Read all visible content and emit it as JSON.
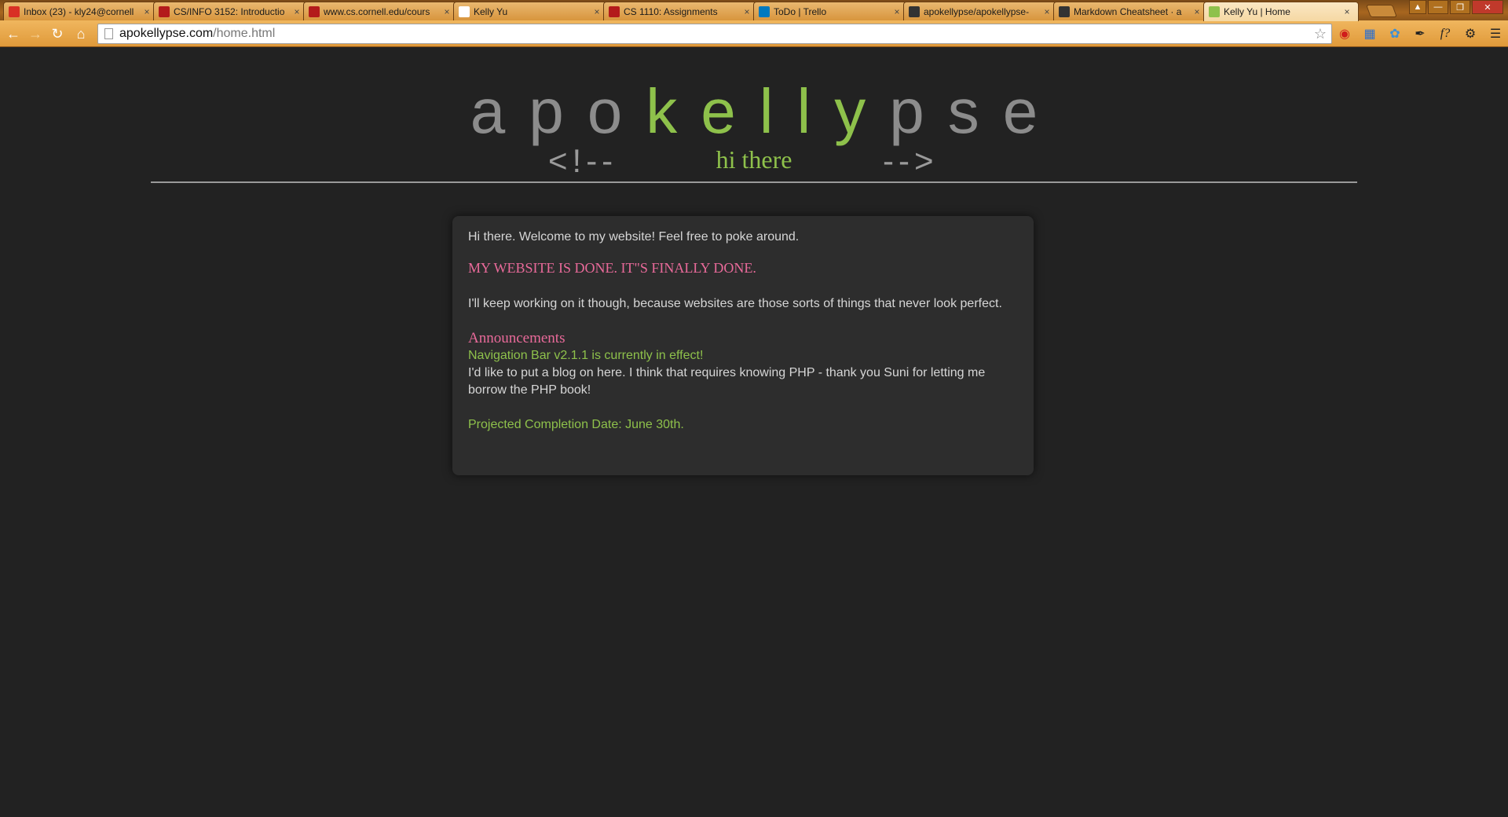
{
  "browser": {
    "tabs": [
      {
        "title": "Inbox (23) - kly24@cornell",
        "favicon": "gmail-icon",
        "color": "#d93025"
      },
      {
        "title": "CS/INFO 3152: Introductio",
        "favicon": "cornell-icon",
        "color": "#b31b1b"
      },
      {
        "title": "www.cs.cornell.edu/cours",
        "favicon": "cornell-icon",
        "color": "#b31b1b"
      },
      {
        "title": "Kelly Yu",
        "favicon": "page-icon",
        "color": "#ffffff"
      },
      {
        "title": "CS 1110: Assignments",
        "favicon": "cornell-icon",
        "color": "#b31b1b"
      },
      {
        "title": "ToDo | Trello",
        "favicon": "trello-icon",
        "color": "#0079bf"
      },
      {
        "title": "apokellypse/apokellypse-",
        "favicon": "github-icon",
        "color": "#333333"
      },
      {
        "title": "Markdown Cheatsheet · a",
        "favicon": "github-icon",
        "color": "#333333"
      },
      {
        "title": "Kelly Yu | Home",
        "favicon": "v-icon",
        "color": "#8ec14b",
        "active": true
      }
    ],
    "url_host": "apokellypse.com",
    "url_path": "/home.html"
  },
  "site": {
    "title_part1": "apo",
    "title_highlight": "kelly",
    "title_part2": "pse",
    "bracket_left": "<!--",
    "bracket_right": "-->",
    "page_label": "hi there"
  },
  "content": {
    "welcome": "Hi there. Welcome to my website! Feel free to poke around.",
    "done": "MY WEBSITE IS DONE. IT\"S FINALLY DONE.",
    "keep": "I'll keep working on it though, because websites are those sorts of things that never look perfect.",
    "announcements_title": "Announcements",
    "navbar_note": "Navigation Bar v2.1.1 is currently in effect!",
    "blog_note": "I'd like to put a blog on here. I think that requires knowing PHP - thank you Suni for letting me borrow the PHP book!",
    "completion": "Projected Completion Date: June 30th."
  },
  "colors": {
    "accent_green": "#8ec14b",
    "accent_pink": "#e96a9a",
    "background": "#222222",
    "card": "#2d2d2d"
  }
}
